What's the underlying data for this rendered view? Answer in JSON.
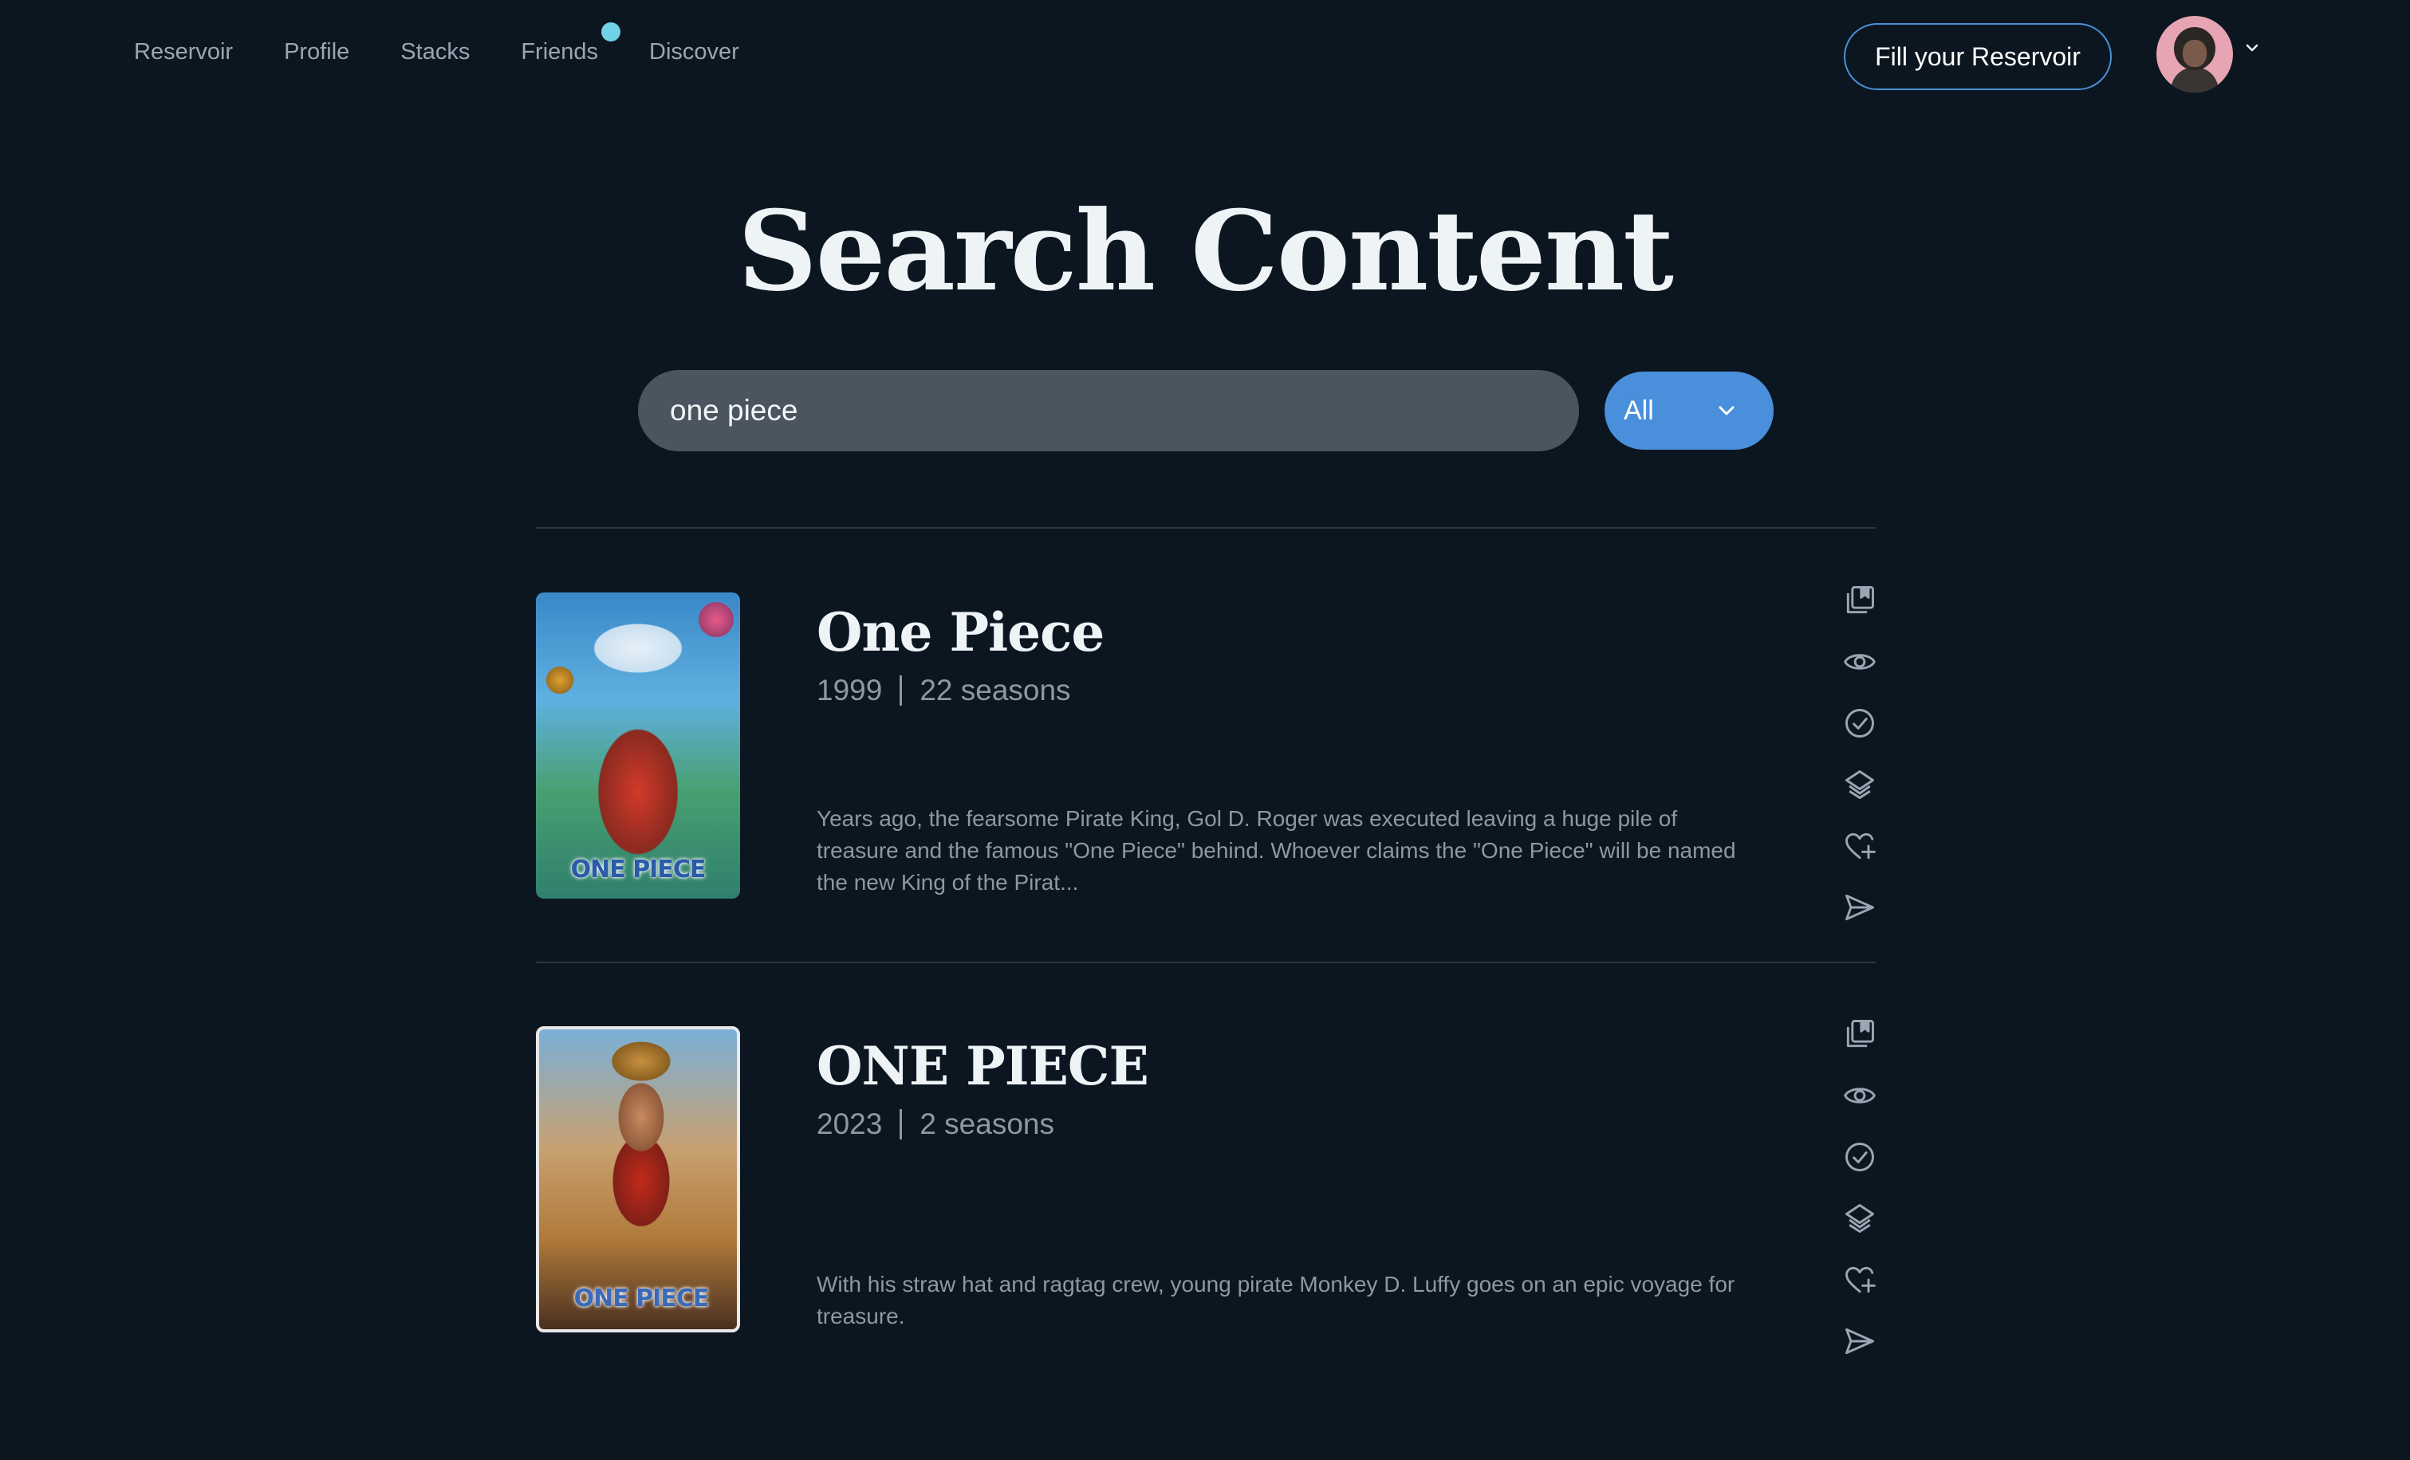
{
  "nav": {
    "links": [
      "Reservoir",
      "Profile",
      "Stacks",
      "Friends",
      "Discover"
    ],
    "cta_label": "Fill your Reservoir"
  },
  "page": {
    "title": "Search Content"
  },
  "search": {
    "value": "one piece",
    "filter": "All"
  },
  "results": [
    {
      "title": "One Piece",
      "year": "1999",
      "seasons": "22 seasons",
      "description": "Years ago, the fearsome Pirate King, Gol D. Roger was executed leaving a huge pile of treasure and the famous \"One Piece\" behind. Whoever claims the \"One Piece\" will be named the new King of the Pirat...",
      "poster_logo": "ONE PIECE"
    },
    {
      "title": "ONE PIECE",
      "year": "2023",
      "seasons": "2 seasons",
      "description": "With his straw hat and ragtag crew, young pirate Monkey D. Luffy goes on an epic voyage for treasure.",
      "poster_logo": "ONE PIECE"
    }
  ],
  "action_icons": [
    "bookmark-stack-icon",
    "eye-icon",
    "check-circle-icon",
    "layers-icon",
    "heart-plus-icon",
    "send-icon"
  ],
  "colors": {
    "background": "#0c1620",
    "accent": "#4a8fdc",
    "notification": "#6fd2e6"
  }
}
